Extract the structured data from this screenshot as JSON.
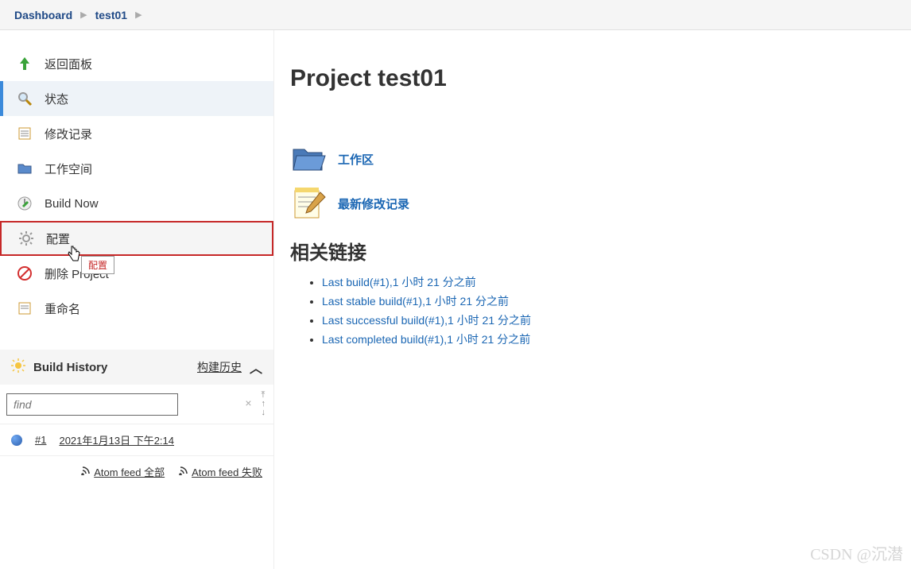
{
  "breadcrumb": {
    "root": "Dashboard",
    "item": "test01"
  },
  "sidebar": {
    "items": [
      {
        "label": "返回面板"
      },
      {
        "label": "状态"
      },
      {
        "label": "修改记录"
      },
      {
        "label": "工作空间"
      },
      {
        "label": "Build Now"
      },
      {
        "label": "配置"
      },
      {
        "label": "删除 Project"
      },
      {
        "label": "重命名"
      }
    ],
    "tooltip": "配置"
  },
  "history": {
    "title": "Build History",
    "trend_label": "构建历史",
    "placeholder": "find",
    "builds": [
      {
        "id": "#1",
        "date": "2021年1月13日 下午2:14"
      }
    ],
    "feed_all": "Atom feed 全部",
    "feed_fail": "Atom feed 失败"
  },
  "main": {
    "title": "Project test01",
    "links": {
      "workspace": "工作区",
      "changes": "最新修改记录"
    },
    "related_heading": "相关链接",
    "related": [
      "Last build(#1),1 小时 21 分之前",
      "Last stable build(#1),1 小时 21 分之前",
      "Last successful build(#1),1 小时 21 分之前",
      "Last completed build(#1),1 小时 21 分之前"
    ]
  },
  "watermark": "CSDN @沉潜"
}
